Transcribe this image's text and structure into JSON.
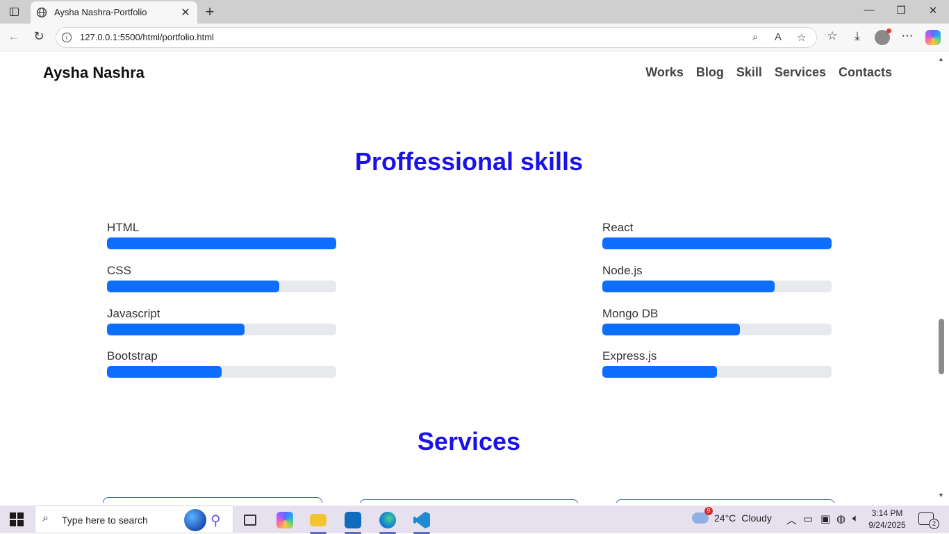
{
  "browser": {
    "tab_title": "Aysha Nashra-Portfolio",
    "tab_close": "✕",
    "new_tab": "+",
    "url": "127.0.0.1:5500/html/portfolio.html",
    "window_controls": {
      "minimize": "—",
      "restore": "❐",
      "close": "✕"
    }
  },
  "site": {
    "brand": "Aysha Nashra",
    "nav": [
      "Works",
      "Blog",
      "Skill",
      "Services",
      "Contacts"
    ]
  },
  "skills": {
    "heading": "Proffessional skills",
    "left": [
      {
        "label": "HTML",
        "percent": 100
      },
      {
        "label": "CSS",
        "percent": 75
      },
      {
        "label": "Javascript",
        "percent": 60
      },
      {
        "label": "Bootstrap",
        "percent": 50
      }
    ],
    "right": [
      {
        "label": "React",
        "percent": 100
      },
      {
        "label": "Node.js",
        "percent": 75
      },
      {
        "label": "Mongo DB",
        "percent": 60
      },
      {
        "label": "Express.js",
        "percent": 50
      }
    ],
    "bar_color": "#0d6efd",
    "track_color": "#e7e9ec"
  },
  "services": {
    "heading": "Services"
  },
  "colors": {
    "heading": "#1a12e6"
  },
  "taskbar": {
    "search_placeholder": "Type here to search",
    "weather": {
      "temp": "24°C",
      "condition": "Cloudy",
      "badge": "9"
    },
    "time": "3:14 PM",
    "date": "9/24/2025",
    "notifications": "2"
  }
}
